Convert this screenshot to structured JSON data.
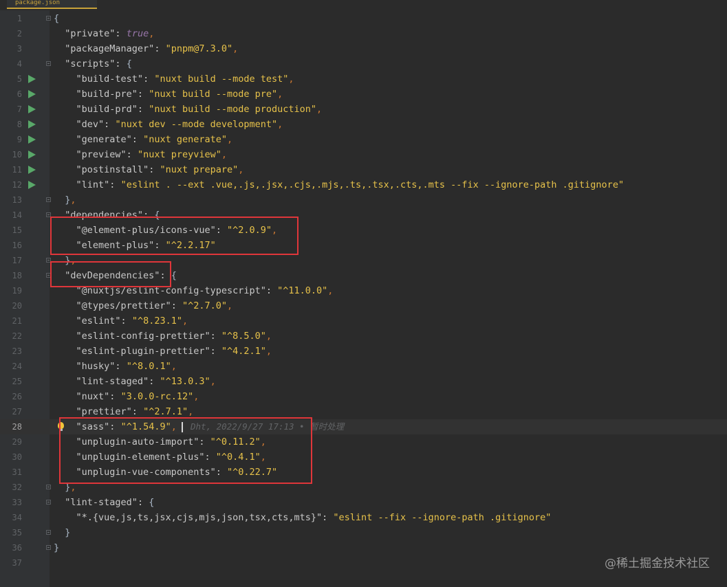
{
  "tab": {
    "label": "package.json"
  },
  "lines": [
    {
      "n": "1",
      "text": "{"
    },
    {
      "n": "2",
      "text": "  \"private\": true,"
    },
    {
      "n": "3",
      "text": "  \"packageManager\": \"pnpm@7.3.0\","
    },
    {
      "n": "4",
      "text": "  \"scripts\": {"
    },
    {
      "n": "5",
      "text": "    \"build-test\": \"nuxt build --mode test\","
    },
    {
      "n": "6",
      "text": "    \"build-pre\": \"nuxt build --mode pre\","
    },
    {
      "n": "7",
      "text": "    \"build-prd\": \"nuxt build --mode production\","
    },
    {
      "n": "8",
      "text": "    \"dev\": \"nuxt dev --mode development\","
    },
    {
      "n": "9",
      "text": "    \"generate\": \"nuxt generate\","
    },
    {
      "n": "10",
      "text": "    \"preview\": \"nuxt preyview\","
    },
    {
      "n": "11",
      "text": "    \"postinstall\": \"nuxt prepare\","
    },
    {
      "n": "12",
      "text": "    \"lint\": \"eslint . --ext .vue,.js,.jsx,.cjs,.mjs,.ts,.tsx,.cts,.mts --fix --ignore-path .gitignore\""
    },
    {
      "n": "13",
      "text": "  },"
    },
    {
      "n": "14",
      "text": "  \"dependencies\": {"
    },
    {
      "n": "15",
      "text": "    \"@element-plus/icons-vue\": \"^2.0.9\","
    },
    {
      "n": "16",
      "text": "    \"element-plus\": \"^2.2.17\""
    },
    {
      "n": "17",
      "text": "  },"
    },
    {
      "n": "18",
      "text": "  \"devDependencies\": {"
    },
    {
      "n": "19",
      "text": "    \"@nuxtjs/eslint-config-typescript\": \"^11.0.0\","
    },
    {
      "n": "20",
      "text": "    \"@types/prettier\": \"^2.7.0\","
    },
    {
      "n": "21",
      "text": "    \"eslint\": \"^8.23.1\","
    },
    {
      "n": "22",
      "text": "    \"eslint-config-prettier\": \"^8.5.0\","
    },
    {
      "n": "23",
      "text": "    \"eslint-plugin-prettier\": \"^4.2.1\","
    },
    {
      "n": "24",
      "text": "    \"husky\": \"^8.0.1\","
    },
    {
      "n": "25",
      "text": "    \"lint-staged\": \"^13.0.3\","
    },
    {
      "n": "26",
      "text": "    \"nuxt\": \"3.0.0-rc.12\","
    },
    {
      "n": "27",
      "text": "    \"prettier\": \"^2.7.1\","
    },
    {
      "n": "28",
      "text": "    \"sass\": \"^1.54.9\","
    },
    {
      "n": "29",
      "text": "    \"unplugin-auto-import\": \"^0.11.2\","
    },
    {
      "n": "30",
      "text": "    \"unplugin-element-plus\": \"^0.4.1\","
    },
    {
      "n": "31",
      "text": "    \"unplugin-vue-components\": \"^0.22.7\""
    },
    {
      "n": "32",
      "text": "  },"
    },
    {
      "n": "33",
      "text": "  \"lint-staged\": {"
    },
    {
      "n": "34",
      "text": "    \"*.{vue,js,ts,jsx,cjs,mjs,json,tsx,cts,mts}\": \"eslint --fix --ignore-path .gitignore\""
    },
    {
      "n": "35",
      "text": "  }"
    },
    {
      "n": "36",
      "text": "}"
    },
    {
      "n": "37",
      "text": ""
    }
  ],
  "run_lines": [
    "5",
    "6",
    "7",
    "8",
    "9",
    "10",
    "11",
    "12"
  ],
  "fold_lines": [
    "1",
    "4",
    "13",
    "14",
    "17",
    "18",
    "32",
    "33",
    "35",
    "36"
  ],
  "current_line": "28",
  "blame": "Dht, 2022/9/27 17:13 • 暂时处理",
  "watermark": "@稀土掘金技术社区",
  "icons": {
    "run": "run-triangle-icon",
    "fold": "fold-marker-icon",
    "bulb": "intention-bulb-icon"
  },
  "colors": {
    "background": "#2b2b2b",
    "gutter": "#313335",
    "key": "#c9c9c9",
    "string": "#e7c24a",
    "keyword": "#9876aa",
    "highlight_box": "#e0363a",
    "run": "#59a869"
  }
}
